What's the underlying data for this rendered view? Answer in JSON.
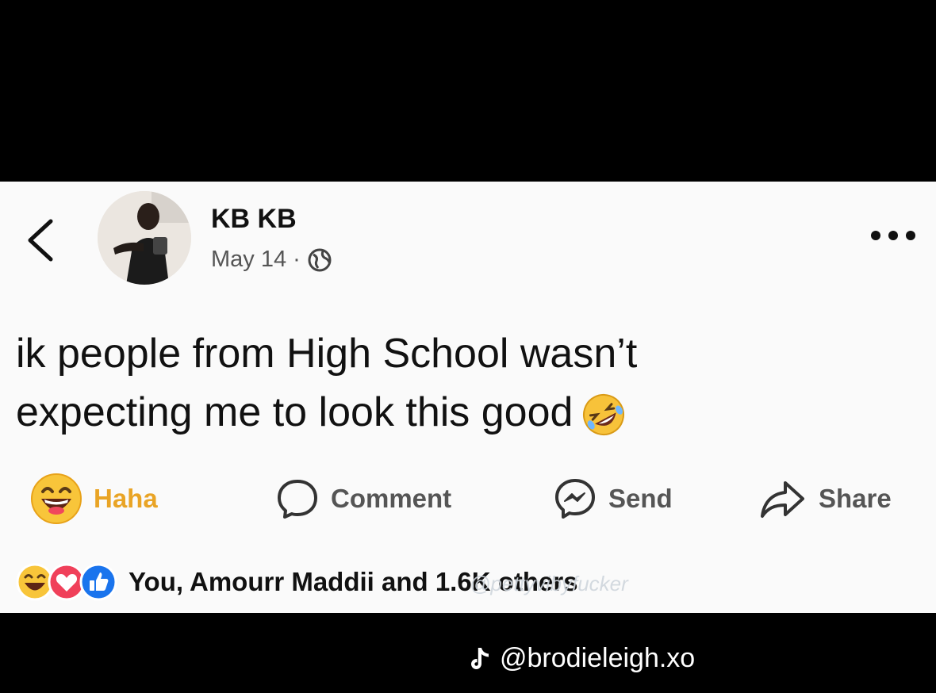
{
  "post": {
    "author": "KB KB",
    "date": "May 14",
    "separator": "·",
    "text": "ik people from High School wasn’t expecting me to look this good",
    "text_emoji_icon": "rolling-on-floor-laughing-emoji"
  },
  "actions": {
    "haha": "Haha",
    "comment": "Comment",
    "send": "Send",
    "share": "Share"
  },
  "reactions": {
    "summary": "You, Amourr Maddii and 1.6K others",
    "icons": [
      "haha-reaction",
      "love-reaction",
      "like-reaction"
    ]
  },
  "watermark": "@pettyvibyfucker",
  "tiktok": {
    "handle": "@brodieleigh.xo",
    "icon": "tiktok-icon"
  },
  "colors": {
    "haha": "#e9a425",
    "love": "#f0405a",
    "like": "#1a74ed",
    "background": "#fafafa"
  }
}
